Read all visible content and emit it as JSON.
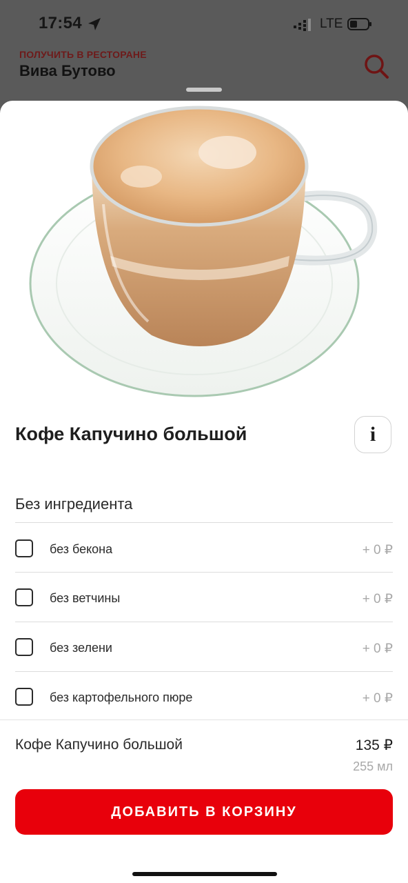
{
  "status_bar": {
    "time": "17:54",
    "network": "LTE",
    "icons": [
      "location-arrow-icon",
      "signal-icon",
      "battery-icon"
    ]
  },
  "header": {
    "subtitle": "ПОЛУЧИТЬ В РЕСТОРАНЕ",
    "title": "Вива Бутово",
    "search_icon": "search-icon"
  },
  "product": {
    "title": "Кофе Капучино большой",
    "info_label": "i",
    "image": "cappuccino-cup-photo"
  },
  "ingredients": {
    "section_title": "Без ингредиента",
    "options": [
      {
        "label": "без бекона",
        "price": "+ 0 ₽",
        "checked": false
      },
      {
        "label": "без ветчины",
        "price": "+ 0 ₽",
        "checked": false
      },
      {
        "label": "без зелени",
        "price": "+ 0 ₽",
        "checked": false
      },
      {
        "label": "без картофельного пюре",
        "price": "+ 0 ₽",
        "checked": false
      }
    ]
  },
  "summary": {
    "name": "Кофе Капучино большой",
    "price": "135 ₽",
    "volume": "255 мл"
  },
  "cta": {
    "add_to_cart_label": "ДОБАВИТЬ В КОРЗИНУ"
  },
  "colors": {
    "accent": "#e8000b",
    "header_subtitle": "#6e1a1a",
    "overlay_bg": "#5a5a5a",
    "muted_text": "#a8a8a8"
  }
}
